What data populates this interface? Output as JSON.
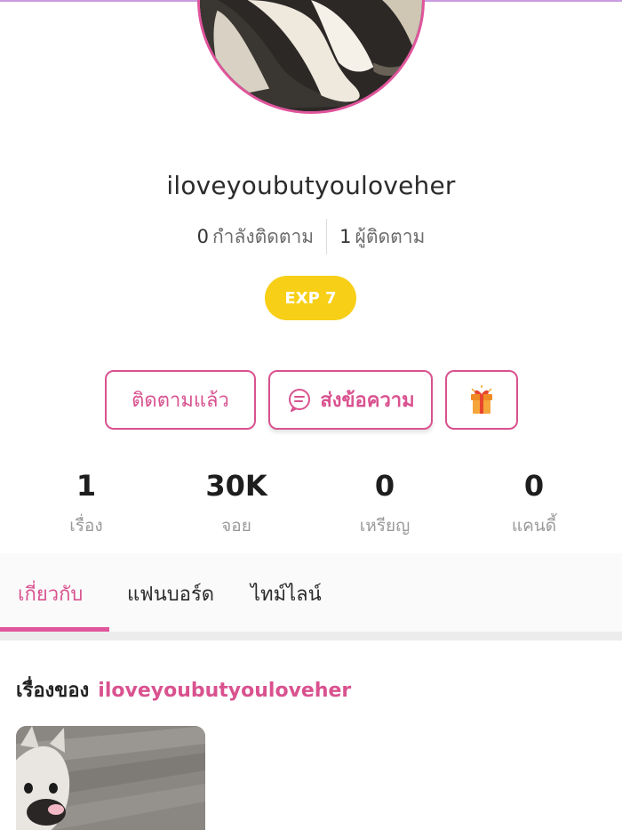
{
  "profile": {
    "username": "iloveyoubutyouloveher",
    "following_count": "0",
    "following_label": "กำลังติดตาม",
    "followers_count": "1",
    "followers_label": "ผู้ติดตาม",
    "exp_badge": "EXP 7"
  },
  "actions": {
    "following_label": "ติดตามแล้ว",
    "message_label": "ส่งข้อความ",
    "gift_icon": "gift-icon",
    "message_icon": "chat-bubble-icon"
  },
  "stats": [
    {
      "value": "1",
      "label": "เรื่อง"
    },
    {
      "value": "30K",
      "label": "จอย"
    },
    {
      "value": "0",
      "label": "เหรียญ"
    },
    {
      "value": "0",
      "label": "แคนดี้"
    }
  ],
  "tabs": [
    {
      "label": "เกี่ยวกับ",
      "active": true
    },
    {
      "label": "แฟนบอร์ด",
      "active": false
    },
    {
      "label": "ไทม์ไลน์",
      "active": false
    }
  ],
  "stories_section": {
    "title": "เรื่องของ",
    "owner": "iloveyoubutyouloveher"
  },
  "colors": {
    "accent": "#d9528f",
    "exp_badge": "#f7cf17"
  }
}
